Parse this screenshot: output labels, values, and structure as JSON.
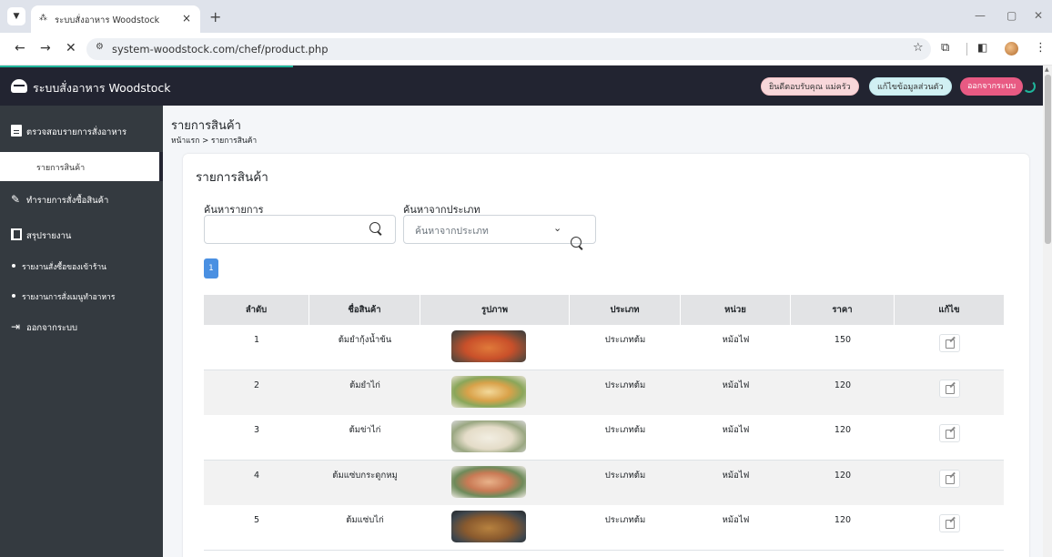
{
  "browser": {
    "tab_title": "ระบบสั่งอาหาร Woodstock",
    "url": "system-woodstock.com/chef/product.php"
  },
  "header": {
    "brand": "ระบบสั่งอาหาร Woodstock",
    "welcome": "ยินดีตอบรับคุณ แม่ครัว",
    "edit_profile": "แก้ไขข้อมูลส่วนตัว",
    "logout": "ออกจากระบบ"
  },
  "sidebar": {
    "orders": "ตรวจสอบรายการสั่งอาหาร",
    "products": "รายการสินค้า",
    "purchase": "ทำรายการสั่งซื้อสินค้า",
    "report": "สรุปรายงาน",
    "report_purchase": "รายงานสั่งซื้อของเข้าร้าน",
    "report_menu": "รายงานการสั่งเมนูทำอาหาร",
    "logout": "ออกจากระบบ"
  },
  "page": {
    "title": "รายการสินค้า",
    "breadcrumb": "หน้าแรก > รายการสินค้า",
    "card_title": "รายการสินค้า"
  },
  "search": {
    "label": "ค้นหารายการ",
    "category_label": "ค้นหาจากประเภท",
    "category_placeholder": "ค้นหาจากประเภท"
  },
  "pagination": {
    "current": "1"
  },
  "table": {
    "headers": [
      "ลำดับ",
      "ชื่อสินค้า",
      "รูปภาพ",
      "ประเภท",
      "หน่วย",
      "ราคา",
      "แก้ไข"
    ],
    "rows": [
      {
        "no": "1",
        "name": "ต้มยำกุ้งน้ำข้น",
        "type": "ประเภทต้ม",
        "unit": "หม้อไฟ",
        "price": "150"
      },
      {
        "no": "2",
        "name": "ต้มยำไก่",
        "type": "ประเภทต้ม",
        "unit": "หม้อไฟ",
        "price": "120"
      },
      {
        "no": "3",
        "name": "ต้มข่าไก่",
        "type": "ประเภทต้ม",
        "unit": "หม้อไฟ",
        "price": "120"
      },
      {
        "no": "4",
        "name": "ต้มแซ่บกระดูกหมู",
        "type": "ประเภทต้ม",
        "unit": "หม้อไฟ",
        "price": "120"
      },
      {
        "no": "5",
        "name": "ต้มแซ่บไก่",
        "type": "ประเภทต้ม",
        "unit": "หม้อไฟ",
        "price": "120"
      }
    ]
  },
  "colors": {
    "sidebar_bg": "#343a40",
    "header_bg": "#222431",
    "accent": "#1fb59b",
    "logout_pill": "#e85a83",
    "page_button": "#4a90e2"
  }
}
